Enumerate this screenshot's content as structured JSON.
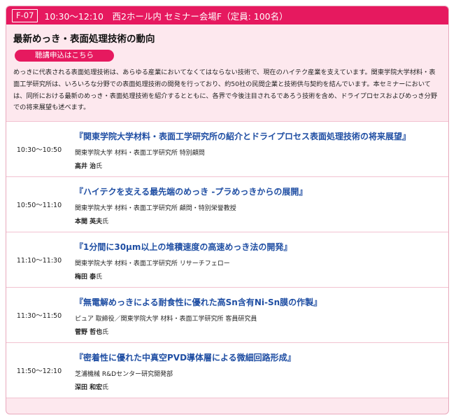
{
  "session": {
    "code": "F-07",
    "header": "10:30～12:10　西2ホール内 セミナー会場F（定員: 100名）",
    "title": "最新めっき・表面処理技術の動向",
    "apply_label": "聴講申込はこちら",
    "description": "めっきに代表される表面処理技術は、あらゆる産業においてなくてはならない技術で、現在のハイテク産業を支えています。関東学院大学材料・表面工学研究所は、いろいろな分野での表面処理技術の開発を行っており、約50社の民間企業と技術供与契約を結んでいます。本セミナーにおいては、同所における最新のめっき・表面処理技術を紹介するとともに、各界で今後注目されるであろう技術を含め、ドライプロセスおよびめっき分野での将来展望も述べます。"
  },
  "colors": {
    "accent": "#e6195f",
    "card_bg": "#fde8ee",
    "link": "#1f4ea3"
  },
  "talks": [
    {
      "time": "10:30～10:50",
      "title": "『関東学院大学材料・表面工学研究所の紹介とドライプロセス表面処理技術の将来展望』",
      "affiliation": "関東学院大学 材料・表面工学研究所 特別顧問",
      "speaker": "高井 治",
      "honorific": "氏"
    },
    {
      "time": "10:50～11:10",
      "title": "『ハイテクを支える最先端のめっき -プラめっきからの展開』",
      "affiliation": "関東学院大学 材料・表面工学研究所 顧問・特別栄誉教授",
      "speaker": "本間 英夫",
      "honorific": "氏"
    },
    {
      "time": "11:10～11:30",
      "title": "『1分間に30μm以上の堆積速度の高速めっき法の開発』",
      "affiliation": "関東学院大学 材料・表面工学研究所 リサーチフェロー",
      "speaker": "梅田 泰",
      "honorific": "氏"
    },
    {
      "time": "11:30～11:50",
      "title": "『無電解めっきによる耐食性に優れた高Sn含有Ni-Sn膜の作製』",
      "affiliation": "ピュア 取締役／関東学院大学 材料・表面工学研究所 客員研究員",
      "speaker": "菅野 哲也",
      "honorific": "氏"
    },
    {
      "time": "11:50～12:10",
      "title": "『密着性に優れた中真空PVD導体層による微細回路形成』",
      "affiliation": "芝浦機械 R&Dセンター研究開発部",
      "speaker": "深田 和宏",
      "honorific": "氏"
    }
  ]
}
